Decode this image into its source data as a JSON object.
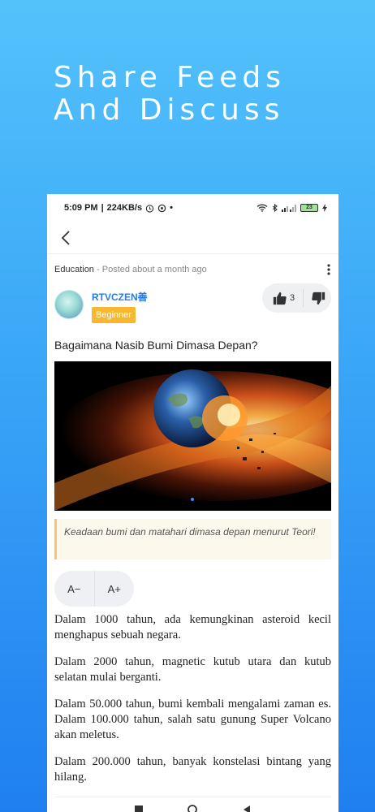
{
  "headline": {
    "line1": "Share Feeds",
    "line2": "And Discuss"
  },
  "statusbar": {
    "time": "5:09 PM",
    "speed": "224KB/s",
    "battery": "23"
  },
  "post": {
    "category": "Education",
    "posted": "Posted about a month ago",
    "author": {
      "name": "RTVCZEN善",
      "badge": "Beginner"
    },
    "likes": "3",
    "title": "Bagaimana Nasib Bumi Dimasa Depan?",
    "quote": "Keadaan bumi dan matahari dimasa depan menurut Teori!",
    "font_decrease": "A−",
    "font_increase": "A+",
    "paragraphs": [
      "Dalam 1000 tahun, ada kemungkinan asteroid  kecil menghapus sebuah negara.",
      "Dalam 2000  tahun, magnetic kutub utara dan kutub selatan  mulai berganti.",
      "Dalam 50.000 tahun, bumi kembali  mengalami zaman es. Dalam 100.000 tahun, salah  satu gunung Super Volcano akan meletus.",
      "Dalam  200.000 tahun, banyak konstelasi bintang yang  hilang."
    ]
  },
  "colors": {
    "accent": "#2b7be0",
    "badge": "#f7b731",
    "background_top": "#53c2fb",
    "background_bottom": "#1f7ff0"
  },
  "icons": [
    "chevron-left-icon",
    "kebab-menu-icon",
    "thumbs-up-icon",
    "thumbs-down-icon",
    "wifi-icon",
    "bluetooth-icon",
    "signal-icon",
    "battery-icon",
    "alarm-icon",
    "nav-square-icon",
    "nav-circle-icon",
    "nav-triangle-icon"
  ]
}
